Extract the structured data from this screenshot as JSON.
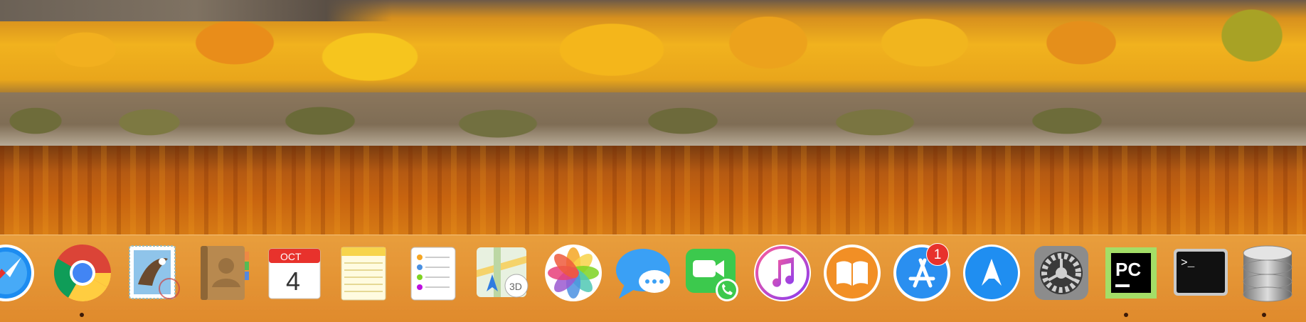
{
  "dock": {
    "items": [
      {
        "id": "safari",
        "icon": "safari-icon",
        "running": false
      },
      {
        "id": "chrome",
        "icon": "chrome-icon",
        "running": true
      },
      {
        "id": "mail",
        "icon": "mail-stamp-eagle-icon",
        "running": false
      },
      {
        "id": "contacts",
        "icon": "contacts-book-icon",
        "running": false
      },
      {
        "id": "calendar",
        "icon": "calendar-icon",
        "month": "OCT",
        "day": "4",
        "running": false
      },
      {
        "id": "notes",
        "icon": "notes-icon",
        "running": false
      },
      {
        "id": "reminders",
        "icon": "reminders-icon",
        "running": false
      },
      {
        "id": "maps",
        "icon": "maps-icon",
        "label_3d": "3D",
        "running": false
      },
      {
        "id": "photos",
        "icon": "photos-icon",
        "running": false
      },
      {
        "id": "messages",
        "icon": "messages-icon",
        "running": false
      },
      {
        "id": "facetime",
        "icon": "facetime-icon",
        "running": false
      },
      {
        "id": "itunes",
        "icon": "itunes-icon",
        "running": false
      },
      {
        "id": "ibooks",
        "icon": "ibooks-icon",
        "running": false
      },
      {
        "id": "app-store",
        "icon": "app-store-icon",
        "badge": "1",
        "running": false
      },
      {
        "id": "airdroid",
        "icon": "airdroid-icon",
        "running": false
      },
      {
        "id": "system-preferences",
        "icon": "gear-icon",
        "running": false
      },
      {
        "id": "pycharm",
        "icon": "pycharm-icon",
        "text": "PC",
        "running": true
      },
      {
        "id": "terminal",
        "icon": "terminal-icon",
        "prompt": ">_",
        "running": false
      },
      {
        "id": "database",
        "icon": "database-icon",
        "running": true
      }
    ]
  },
  "colors": {
    "badge": "#e8322c",
    "dock_tint": "#e89a40",
    "running_dot": "#3b1a08"
  }
}
